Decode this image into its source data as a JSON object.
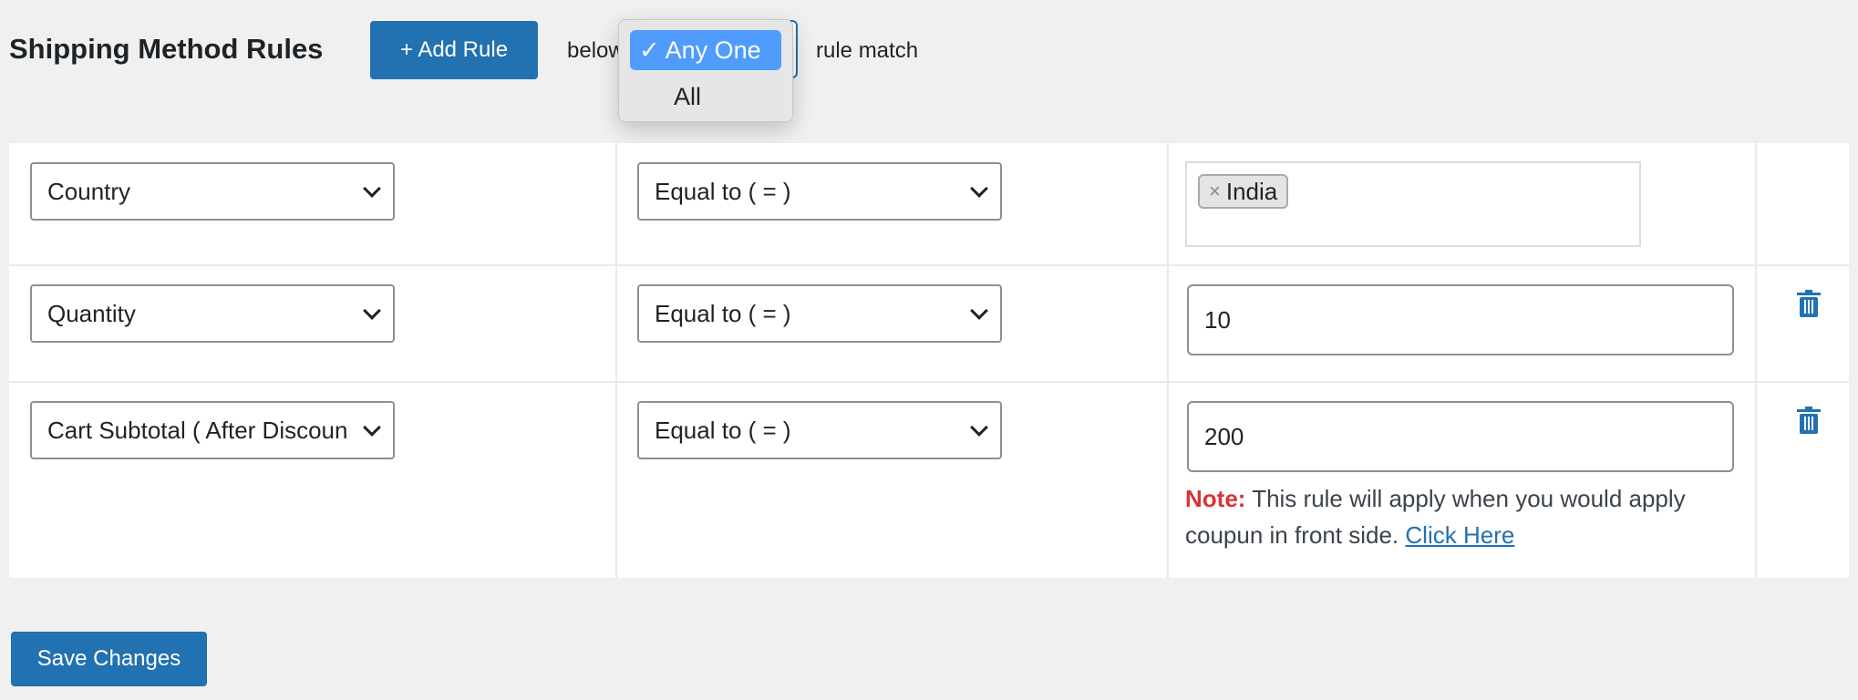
{
  "header": {
    "title": "Shipping Method Rules",
    "add_rule": "+ Add Rule",
    "prefix": "below",
    "suffix": "rule match",
    "match_options": [
      {
        "label": "✓ Any One",
        "selected": true
      },
      {
        "label": "All",
        "selected": false
      }
    ]
  },
  "rules": [
    {
      "field": "Country",
      "operator": "Equal to ( = )",
      "tags": [
        "India"
      ]
    },
    {
      "field": "Quantity",
      "operator": "Equal to ( = )",
      "value": "10"
    },
    {
      "field": "Cart Subtotal ( After Discount )",
      "operator": "Equal to ( = )",
      "value": "200",
      "note_label": "Note:",
      "note_text": " This rule will apply when you would apply coupun in front side. ",
      "note_link": "Click Here"
    }
  ],
  "save_label": "Save Changes",
  "colors": {
    "accent": "#2271b1",
    "note": "#d63638",
    "highlight": "#4f9cfd"
  }
}
